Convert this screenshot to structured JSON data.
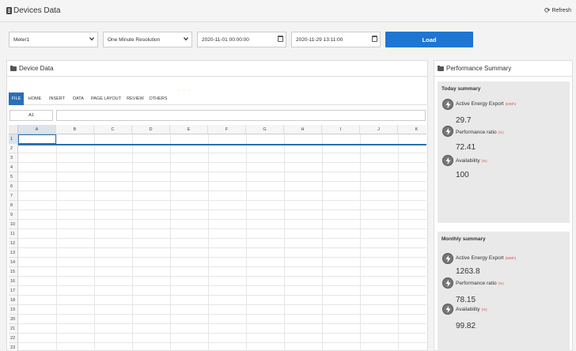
{
  "header": {
    "title": "Devices Data",
    "refresh_label": "Refresh"
  },
  "controls": {
    "meter": "Meter1",
    "resolution": "One Minute Resolution",
    "start_datetime": "2020-11-01 00:00:00",
    "end_datetime": "2020-11-29 13:11:00",
    "load_label": "Load"
  },
  "device_panel": {
    "title": "Device Data",
    "ribbon_tabs": [
      "FILE",
      "HOME",
      "INSERT",
      "DATA",
      "PAGE LAYOUT",
      "REVIEW",
      "OTHERS"
    ],
    "ribbon_more": "· · ·",
    "cell_ref": "A1",
    "columns": [
      "A",
      "B",
      "C",
      "D",
      "E",
      "F",
      "G",
      "H",
      "I",
      "J",
      "K"
    ],
    "rows": [
      "1",
      "2",
      "3",
      "4",
      "5",
      "6",
      "7",
      "8",
      "9",
      "10",
      "11",
      "12",
      "13",
      "14",
      "15",
      "16",
      "17",
      "18",
      "19",
      "20",
      "21",
      "22",
      "23"
    ]
  },
  "summary_panel": {
    "title": "Performance Summary",
    "today": {
      "title": "Today summary",
      "metrics": [
        {
          "label": "Active Energy Export",
          "unit": "(MWh)",
          "value": "29.7"
        },
        {
          "label": "Performance ratio",
          "unit": "(%)",
          "value": "72.41"
        },
        {
          "label": "Availability",
          "unit": "(%)",
          "value": "100"
        }
      ]
    },
    "monthly": {
      "title": "Monthly summary",
      "metrics": [
        {
          "label": "Active Energy Export",
          "unit": "(MWh)",
          "value": "1263.8"
        },
        {
          "label": "Performance ratio",
          "unit": "(%)",
          "value": "78.15"
        },
        {
          "label": "Availability",
          "unit": "(%)",
          "value": "99.82"
        }
      ]
    }
  },
  "colors": {
    "accent": "#1e76d2",
    "selection": "#2a6fb5",
    "unit": "#d9534f"
  }
}
